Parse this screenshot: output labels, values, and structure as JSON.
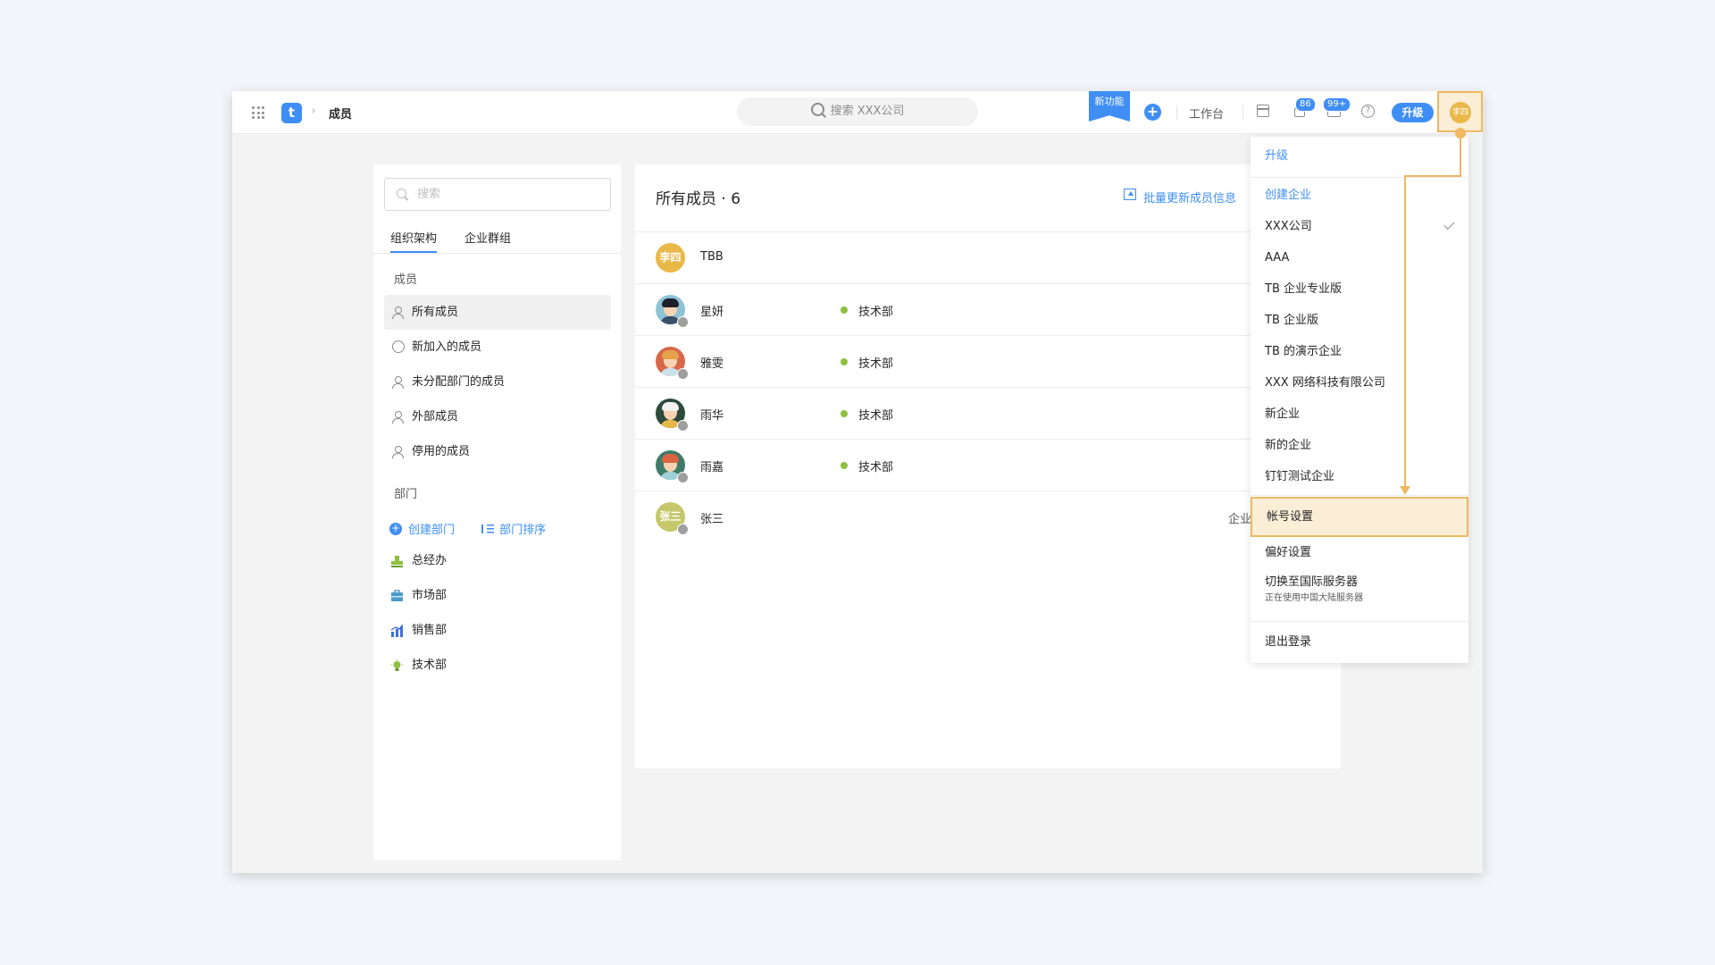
{
  "topbar": {
    "breadcrumb_sep": "›",
    "logo_letter": "t",
    "page_title": "成员",
    "search_placeholder": "搜索 XXX公司",
    "new_feature_label": "新功能",
    "workbench_label": "工作台",
    "notification_count": "86",
    "inbox_count": "99+",
    "help_symbol": "?",
    "upgrade_label": "升级",
    "avatar_text": "李四",
    "accent_color": "#3f8ef5",
    "highlight_color": "#f0b861"
  },
  "sidebar": {
    "search_placeholder": "搜索",
    "tabs": [
      {
        "label": "组织架构",
        "active": true
      },
      {
        "label": "企业群组",
        "active": false
      }
    ],
    "members_section": "成员",
    "member_items": [
      {
        "label": "所有成员",
        "icon": "person-icon",
        "active": true
      },
      {
        "label": "新加入的成员",
        "icon": "user-circle-icon"
      },
      {
        "label": "未分配部门的成员",
        "icon": "person-icon"
      },
      {
        "label": "外部成员",
        "icon": "person-icon"
      },
      {
        "label": "停用的成员",
        "icon": "person-icon"
      }
    ],
    "departments_section": "部门",
    "create_department": "创建部门",
    "sort_departments": "部门排序",
    "departments": [
      {
        "label": "总经办",
        "icon": "stamp-icon"
      },
      {
        "label": "市场部",
        "icon": "briefcase-icon"
      },
      {
        "label": "销售部",
        "icon": "bar-chart-icon"
      },
      {
        "label": "技术部",
        "icon": "lightbulb-icon"
      }
    ]
  },
  "main": {
    "title": "所有成员 · 6",
    "batch_update": "批量更新成员信息",
    "members": [
      {
        "name": "TBB",
        "dept": "",
        "avatar_text": "李四",
        "avatar_color": "#e9b849"
      },
      {
        "name": "星妍",
        "dept": "技术部",
        "avatar_color": "#8ec3d6"
      },
      {
        "name": "雅雯",
        "dept": "技术部",
        "avatar_color": "#d9674a"
      },
      {
        "name": "雨华",
        "dept": "技术部",
        "avatar_color": "#2d4a3c"
      },
      {
        "name": "雨嘉",
        "dept": "技术部",
        "avatar_color": "#3f7b6a"
      },
      {
        "name": "张三",
        "dept": "",
        "avatar_text": "张三",
        "avatar_color": "#c4c86a",
        "extra": "企业"
      }
    ]
  },
  "dropdown": {
    "upgrade": "升级",
    "create_company": "创建企业",
    "companies": [
      {
        "label": "XXX公司",
        "checked": true
      },
      {
        "label": "AAA"
      },
      {
        "label": "TB 企业专业版"
      },
      {
        "label": "TB 企业版"
      },
      {
        "label": "TB 的演示企业"
      },
      {
        "label": "XXX 网络科技有限公司"
      },
      {
        "label": "新企业"
      },
      {
        "label": "新的企业"
      },
      {
        "label": "钉钉测试企业"
      }
    ],
    "account_settings": "帐号设置",
    "preferences": "偏好设置",
    "switch_server": "切换至国际服务器",
    "switch_server_sub": "正在使用中国大陆服务器",
    "logout": "退出登录"
  }
}
